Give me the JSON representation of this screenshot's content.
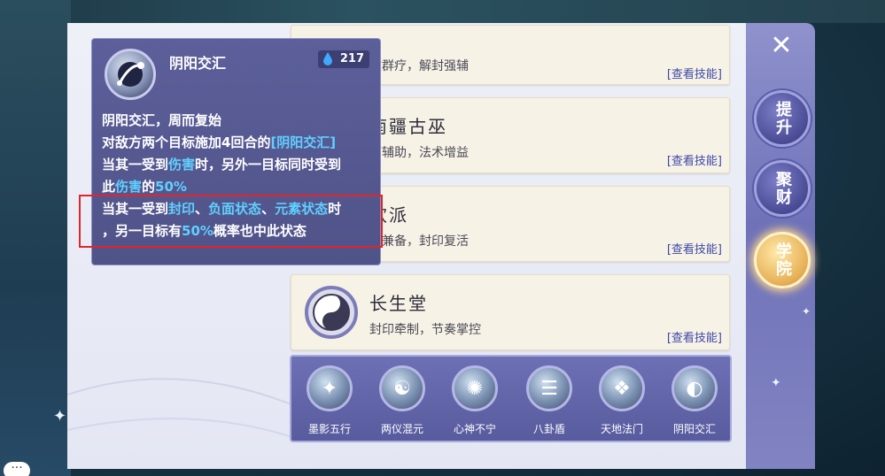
{
  "cards": [
    {
      "name": "",
      "desc": "救群疗，解封强辅",
      "link": "[查看技能]"
    },
    {
      "name": "南疆古巫",
      "desc": "疗辅助，法术增益",
      "link": "[查看技能]"
    },
    {
      "name": "欢派",
      "desc": "守兼备，封印复活",
      "link": "[查看技能]"
    },
    {
      "name": "长生堂",
      "desc": "封印牵制，节奏掌控",
      "link": "[查看技能]"
    }
  ],
  "sidebar": {
    "close_icon": "✕",
    "buttons": [
      "提升",
      "聚财",
      "学院"
    ]
  },
  "skills": [
    {
      "label": "墨影五行",
      "icon": "ink-splash"
    },
    {
      "label": "两仪混元",
      "icon": "yin-yang-swirl"
    },
    {
      "label": "心神不宁",
      "icon": "meditation"
    },
    {
      "label": "八卦盾",
      "icon": "bagua"
    },
    {
      "label": "天地法门",
      "icon": "scroll"
    },
    {
      "label": "阴阳交汇",
      "icon": "yin-yang-orbit"
    }
  ],
  "tooltip": {
    "title": "阴阳交汇",
    "cost": "217",
    "line1": "阴阳交汇，周而复始",
    "line2_a": "对敌方两个目标施加4回合的",
    "line2_b": "[阴阳交汇]",
    "line3_a": "当其一受到",
    "line3_b": "伤害",
    "line3_c": "时，另外一目标同时受到",
    "line4_a": "此",
    "line4_b": "伤害",
    "line4_c": "的",
    "line4_d": "50%",
    "line5_a": "当其一受到",
    "line5_b": "封印",
    "line5_c": "、",
    "line5_d": "负面状态",
    "line5_e": "、",
    "line5_f": "元素状态",
    "line5_g": "时",
    "line6_a": "，另一目标有",
    "line6_b": "50%",
    "line6_c": "概率也中此状态"
  },
  "colors": {
    "highlight": "#5fd0ff",
    "annotation_box": "#e0262b",
    "link": "#3d48a8"
  }
}
